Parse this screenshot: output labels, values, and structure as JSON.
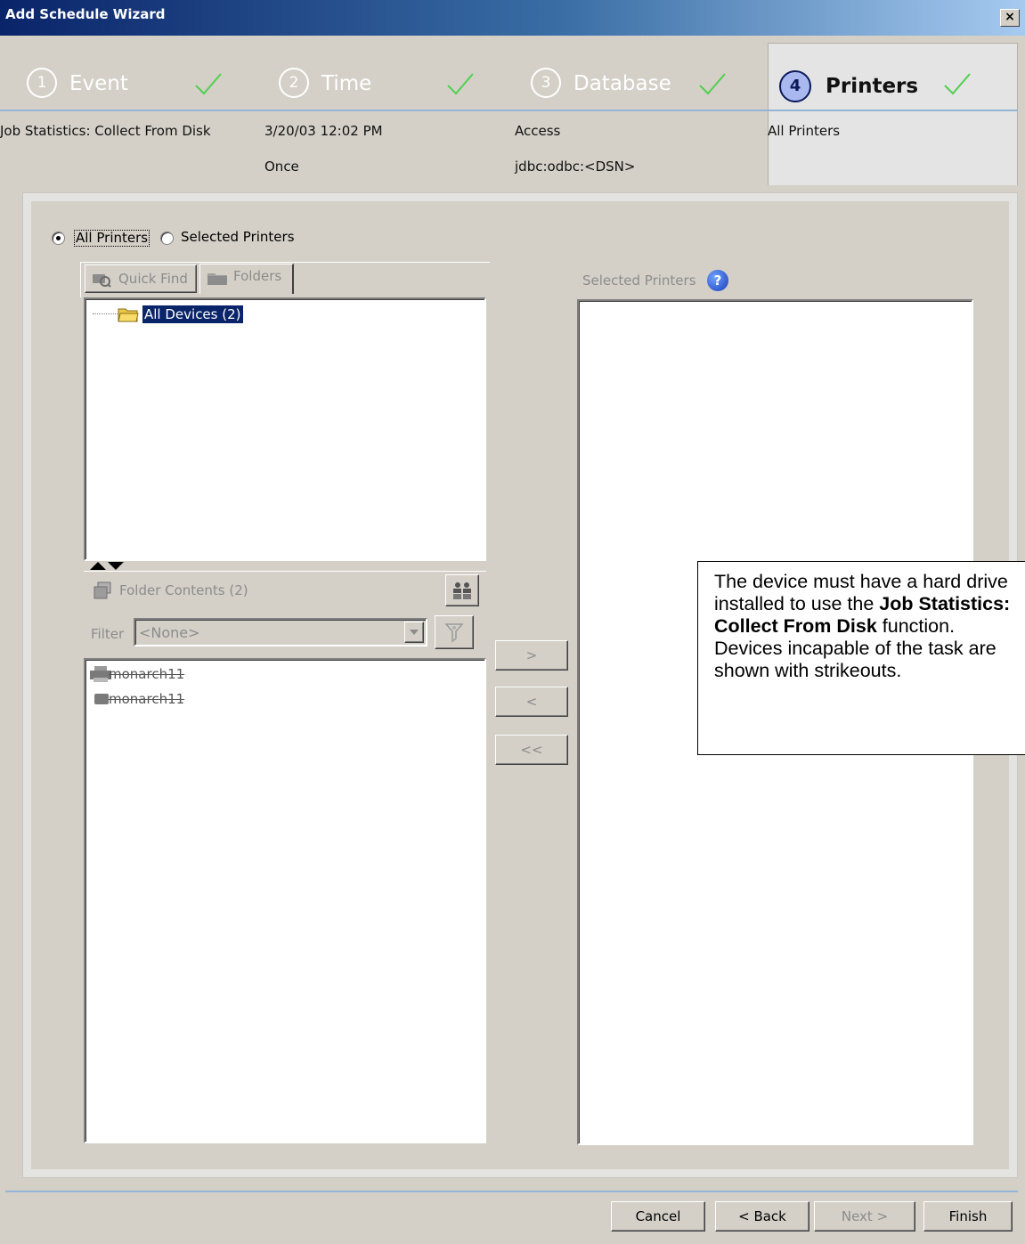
{
  "window": {
    "title": "Add Schedule Wizard",
    "close_glyph": "×"
  },
  "steps": [
    {
      "num": "1",
      "name": "Event",
      "summary": [
        "Job Statistics: Collect From Disk"
      ]
    },
    {
      "num": "2",
      "name": "Time",
      "summary": [
        "3/20/03 12:02 PM",
        "Once"
      ]
    },
    {
      "num": "3",
      "name": "Database",
      "summary": [
        "Access",
        "jdbc:odbc:<DSN>"
      ]
    },
    {
      "num": "4",
      "name": "Printers",
      "summary": [
        "All Printers"
      ]
    }
  ],
  "scope": {
    "all_label": "All Printers",
    "selected_label": "Selected Printers",
    "selected_value": "all"
  },
  "tabs": {
    "quick_find": "Quick Find",
    "folders": "Folders"
  },
  "tree": {
    "root_label": "All Devices (2)"
  },
  "folder_contents": {
    "label": "Folder Contents (2)"
  },
  "filter": {
    "label": "Filter",
    "value": "<None>"
  },
  "devices": [
    {
      "name": "monarch11",
      "icon": "printer-icon",
      "capable": false
    },
    {
      "name": "monarch11",
      "icon": "device-icon",
      "capable": false
    }
  ],
  "transfer": {
    "add": ">",
    "remove": "<",
    "remove_all": "<<"
  },
  "selected_printers": {
    "label": "Selected Printers",
    "help_glyph": "?"
  },
  "note": {
    "pre": "The device must have a hard drive installed to use the ",
    "bold": "Job Statistics: Collect From Disk",
    "post": " function. Devices incapable of the task are shown with strikeouts."
  },
  "footer": {
    "cancel": "Cancel",
    "back": "< Back",
    "next": "Next >",
    "finish": "Finish"
  },
  "colors": {
    "check": "#4fd04f",
    "title_bar": "#0a246a",
    "accent_line": "#94b4d4",
    "selection": "#0a246a"
  }
}
